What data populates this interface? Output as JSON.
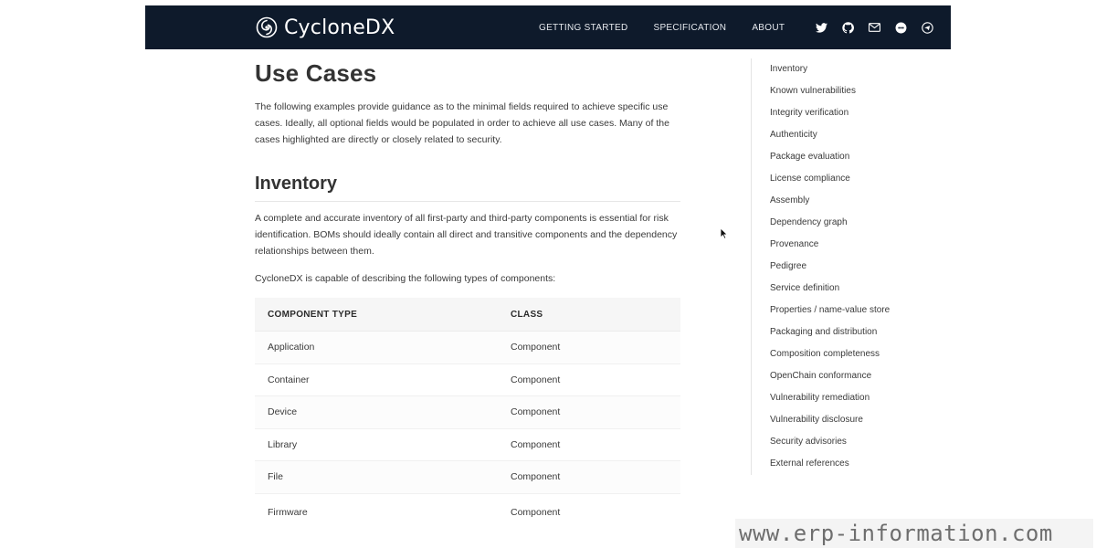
{
  "header": {
    "logo_text": "CycloneDX",
    "nav": [
      "GETTING STARTED",
      "SPECIFICATION",
      "ABOUT"
    ],
    "social_icons": [
      "twitter-icon",
      "github-icon",
      "mail-icon",
      "chat-icon",
      "telegram-icon"
    ]
  },
  "main": {
    "title": "Use Cases",
    "intro": "The following examples provide guidance as to the minimal fields required to achieve specific use cases. Ideally, all optional fields would be populated in order to achieve all use cases. Many of the cases highlighted are directly or closely related to security.",
    "section_title": "Inventory",
    "inventory_p1": "A complete and accurate inventory of all first-party and third-party components is essential for risk identification. BOMs should ideally contain all direct and transitive components and the dependency relationships between them.",
    "inventory_p2": "CycloneDX is capable of describing the following types of components:",
    "table": {
      "headers": [
        "COMPONENT TYPE",
        "CLASS"
      ],
      "rows": [
        [
          "Application",
          "Component"
        ],
        [
          "Container",
          "Component"
        ],
        [
          "Device",
          "Component"
        ],
        [
          "Library",
          "Component"
        ],
        [
          "File",
          "Component"
        ],
        [
          "Firmware",
          "Component"
        ]
      ]
    }
  },
  "toc": [
    "Inventory",
    "Known vulnerabilities",
    "Integrity verification",
    "Authenticity",
    "Package evaluation",
    "License compliance",
    "Assembly",
    "Dependency graph",
    "Provenance",
    "Pedigree",
    "Service definition",
    "Properties / name-value store",
    "Packaging and distribution",
    "Composition completeness",
    "OpenChain conformance",
    "Vulnerability remediation",
    "Vulnerability disclosure",
    "Security advisories",
    "External references"
  ],
  "watermark": "www.erp-information.com",
  "colors": {
    "header_bg": "#0e1a2b",
    "header_text": "#ffffff",
    "body_text": "#3a3a3a"
  }
}
